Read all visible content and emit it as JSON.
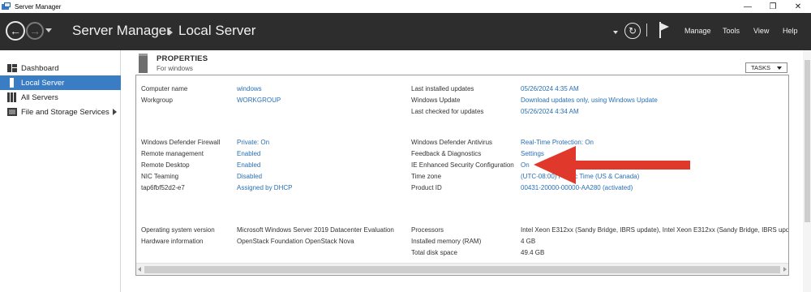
{
  "window": {
    "title": "Server Manager",
    "minimize_glyph": "—",
    "restore_glyph": "❐",
    "close_glyph": "✕"
  },
  "header": {
    "back_glyph": "←",
    "forward_glyph": "→",
    "breadcrumb": [
      "Server Manager",
      "Local Server"
    ],
    "refresh_glyph": "↻",
    "menu": [
      "Manage",
      "Tools",
      "View",
      "Help"
    ]
  },
  "sidebar": {
    "items": [
      {
        "label": "Dashboard",
        "icon": "dashboard-icon"
      },
      {
        "label": "Local Server",
        "icon": "server-icon",
        "selected": true
      },
      {
        "label": "All Servers",
        "icon": "servers-icon"
      },
      {
        "label": "File and Storage Services",
        "icon": "storage-icon",
        "has_arrow": true
      }
    ]
  },
  "properties": {
    "title": "PROPERTIES",
    "subtitle": "For windows",
    "tasks_label": "TASKS",
    "group1_left": [
      {
        "label": "Computer name",
        "value": "windows"
      },
      {
        "label": "Workgroup",
        "value": "WORKGROUP"
      }
    ],
    "group1_right": [
      {
        "label": "Last installed updates",
        "value": "05/26/2024 4:35 AM"
      },
      {
        "label": "Windows Update",
        "value": "Download updates only, using Windows Update"
      },
      {
        "label": "Last checked for updates",
        "value": "05/26/2024 4:34 AM"
      }
    ],
    "group2_left": [
      {
        "label": "Windows Defender Firewall",
        "value": "Private: On"
      },
      {
        "label": "Remote management",
        "value": "Enabled"
      },
      {
        "label": "Remote Desktop",
        "value": "Enabled"
      },
      {
        "label": "NIC Teaming",
        "value": "Disabled"
      },
      {
        "label": "tap6fbf52d2-e7",
        "value": "Assigned by DHCP"
      }
    ],
    "group2_right": [
      {
        "label": "Windows Defender Antivirus",
        "value": "Real-Time Protection: On"
      },
      {
        "label": "Feedback & Diagnostics",
        "value": "Settings"
      },
      {
        "label": "IE Enhanced Security Configuration",
        "value": "On"
      },
      {
        "label": "Time zone",
        "value": "(UTC-08:00) Pacific Time (US & Canada)"
      },
      {
        "label": "Product ID",
        "value": "00431-20000-00000-AA280 (activated)"
      }
    ],
    "group3_left": [
      {
        "label": "Operating system version",
        "value": "Microsoft Windows Server 2019 Datacenter Evaluation"
      },
      {
        "label": "Hardware information",
        "value": "OpenStack Foundation OpenStack Nova"
      }
    ],
    "group3_right": [
      {
        "label": "Processors",
        "value": "Intel Xeon E312xx (Sandy Bridge, IBRS update), Intel Xeon E312xx (Sandy Bridge, IBRS upd"
      },
      {
        "label": "Installed memory (RAM)",
        "value": "4 GB"
      },
      {
        "label": "Total disk space",
        "value": "49.4 GB"
      }
    ]
  },
  "annotation": {
    "arrow_color": "#e0392b"
  }
}
